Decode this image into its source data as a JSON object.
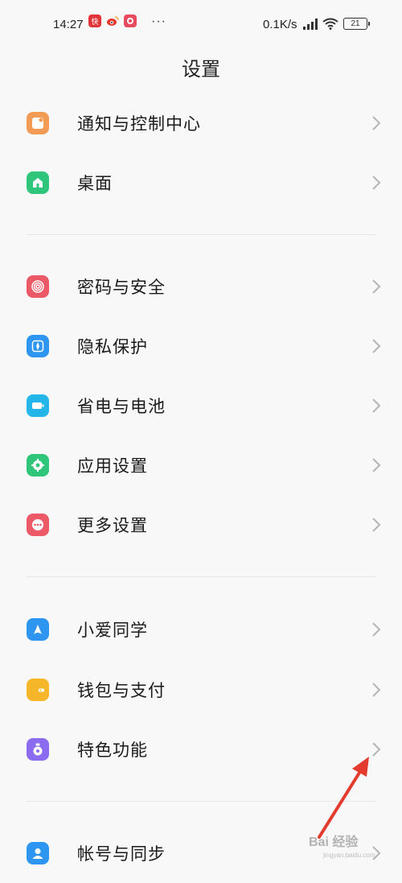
{
  "status_bar": {
    "time": "14:27",
    "net_speed": "0.1K/s",
    "battery": "21",
    "dots": "···",
    "app_icons": [
      {
        "name": "news-app-icon",
        "color": "#e0343a",
        "label": "快"
      },
      {
        "name": "weibo-icon",
        "color": "#f2a33a",
        "label": ""
      },
      {
        "name": "notification-app-icon",
        "color": "#e84a5f",
        "label": ""
      }
    ]
  },
  "title": "设置",
  "items": [
    {
      "label": "通知与控制中心",
      "icon": "notification-center-icon",
      "color": "#f29b54"
    },
    {
      "label": "桌面",
      "icon": "home-icon",
      "color": "#2fc57a"
    },
    {
      "label": "密码与安全",
      "icon": "fingerprint-icon",
      "color": "#ec5a67"
    },
    {
      "label": "隐私保护",
      "icon": "privacy-icon",
      "color": "#2e96f0"
    },
    {
      "label": "省电与电池",
      "icon": "battery-icon",
      "color": "#24b6e8"
    },
    {
      "label": "应用设置",
      "icon": "gear-icon",
      "color": "#2fc57a"
    },
    {
      "label": "更多设置",
      "icon": "more-icon",
      "color": "#ec5a67"
    },
    {
      "label": "小爱同学",
      "icon": "xiaoai-icon",
      "color": "#2e96f0"
    },
    {
      "label": "钱包与支付",
      "icon": "wallet-icon",
      "color": "#f5b629"
    },
    {
      "label": "特色功能",
      "icon": "special-features-icon",
      "color": "#8b6cf0"
    },
    {
      "label": "帐号与同步",
      "icon": "account-icon",
      "color": "#2e96f0"
    }
  ],
  "watermark": "Bai 经验",
  "watermark_sub": "jingyan.baidu.com"
}
